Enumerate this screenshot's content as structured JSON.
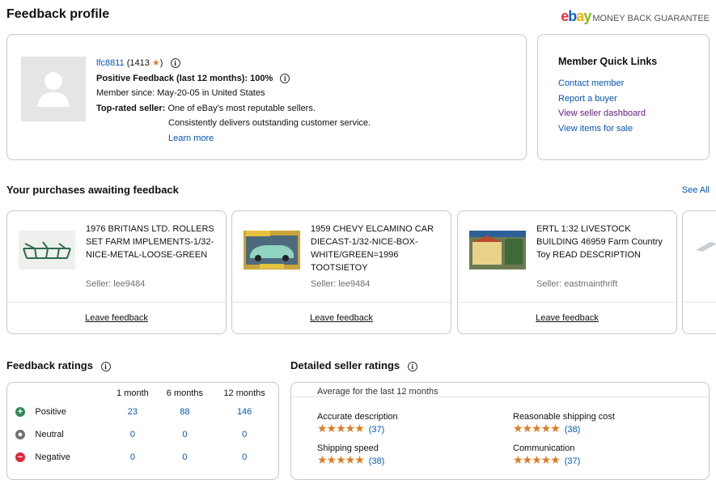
{
  "header": {
    "title": "Feedback profile",
    "mbg_text": "MONEY BACK GUARANTEE"
  },
  "profile": {
    "username": "lfc8811",
    "score": "(1413",
    "score_close": ")",
    "positive_label": "Positive Feedback (last 12 months):",
    "positive_value": "100%",
    "member_since": "Member since: May-20-05 in United States",
    "top_rated_label": "Top-rated seller:",
    "top_rated_text": "One of eBay's most reputable sellers.",
    "top_rated_text2": "Consistently delivers outstanding customer service.",
    "learn_more": "Learn more"
  },
  "quick_links": {
    "title": "Member Quick Links",
    "items": [
      "Contact member",
      "Report a buyer",
      "View seller dashboard",
      "View items for sale"
    ]
  },
  "purchases": {
    "title": "Your purchases awaiting feedback",
    "see_all": "See All",
    "items": [
      {
        "title": "1976 BRITIANS LTD. ROLLERS SET FARM IMPLEMENTS-1/32-NICE-METAL-LOOSE-GREEN",
        "seller": "Seller: lee9484",
        "action": "Leave feedback"
      },
      {
        "title": "1959 CHEVY ELCAMINO CAR DIECAST-1/32-NICE-BOX-WHITE/GREEN=1996 TOOTSIETOY",
        "seller": "Seller: lee9484",
        "action": "Leave feedback"
      },
      {
        "title": "ERTL  1:32 LIVESTOCK BUILDING 46959 Farm Country Toy READ DESCRIPTION",
        "seller": "Seller: eastmainthrift",
        "action": "Leave feedback"
      }
    ]
  },
  "feedback_ratings": {
    "title": "Feedback ratings",
    "columns": [
      "1 month",
      "6 months",
      "12 months"
    ],
    "rows": [
      {
        "label": "Positive",
        "values": [
          "23",
          "88",
          "146"
        ],
        "color": "#2e8b57"
      },
      {
        "label": "Neutral",
        "values": [
          "0",
          "0",
          "0"
        ],
        "color": "#707070"
      },
      {
        "label": "Negative",
        "values": [
          "0",
          "0",
          "0"
        ],
        "color": "#e0263c"
      }
    ]
  },
  "detailed_ratings": {
    "title": "Detailed seller ratings",
    "subtitle": "Average for the last 12 months",
    "items": [
      {
        "label": "Accurate description",
        "stars": "★★★★★",
        "count": "(37)"
      },
      {
        "label": "Reasonable shipping cost",
        "stars": "★★★★★",
        "count": "(38)"
      },
      {
        "label": "Shipping speed",
        "stars": "★★★★★",
        "count": "(38)"
      },
      {
        "label": "Communication",
        "stars": "★★★★★",
        "count": "(37)"
      }
    ]
  }
}
